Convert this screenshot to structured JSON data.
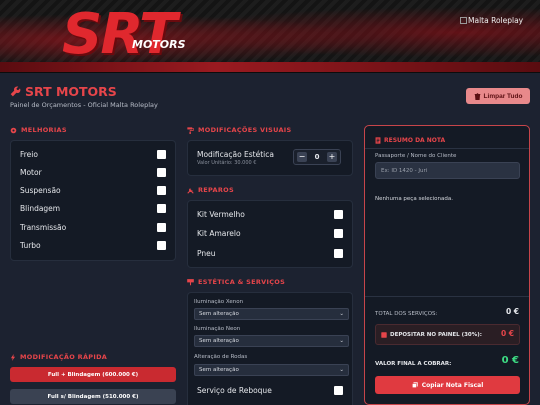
{
  "banner": {
    "logo": "SRT",
    "motors": "MOTORS",
    "image_alt": "Malta Roleplay"
  },
  "header": {
    "title": "SRT MOTORS",
    "subtitle": "Painel de Orçamentos - Oficial Malta Roleplay",
    "clear_label": "Limpar Tudo"
  },
  "melhorias": {
    "title": "MELHORIAS",
    "items": [
      "Freio",
      "Motor",
      "Suspensão",
      "Blindagem",
      "Transmissão",
      "Turbo"
    ]
  },
  "visuais": {
    "title": "MODIFICAÇÕES VISUAIS",
    "name": "Modificação Estética",
    "unit": "Valor Unitário: 30.000 €",
    "qty": "0",
    "minus": "−",
    "plus": "+"
  },
  "reparos": {
    "title": "REPAROS",
    "items": [
      "Kit Vermelho",
      "Kit Amarelo",
      "Pneu"
    ]
  },
  "estetica": {
    "title": "ESTÉTICA & SERVIÇOS",
    "fields": [
      {
        "label": "Iluminação Xenon",
        "value": "Sem alteração"
      },
      {
        "label": "Iluminação Neon",
        "value": "Sem alteração"
      },
      {
        "label": "Alteração de Rodas",
        "value": "Sem alteração"
      }
    ],
    "reboque": "Serviço de Reboque"
  },
  "rapida": {
    "title": "MODIFICAÇÃO RÁPIDA",
    "btn1": "Full + Blindagem (600.000 €)",
    "btn2": "Full s/ Blindagem (510.000 €)"
  },
  "nota": {
    "title": "RESUMO DA NOTA",
    "passport_label": "Passaporte / Nome do Cliente",
    "passport_placeholder": "Ex: ID 1420 - Juri",
    "empty": "Nenhuma peça selecionada.",
    "total_label": "TOTAL DOS SERVIÇOS:",
    "total_value": "0 €",
    "deposit_label": "DEPOSITAR NO PAINEL (30%):",
    "deposit_value": "0 €",
    "final_label": "VALOR FINAL A COBRAR:",
    "final_value": "0 €",
    "copy_label": "Copiar Nota Fiscal"
  },
  "colors": {
    "accent": "#e6454a",
    "panel": "#141a25",
    "bg": "#1c2230",
    "green": "#3ddc84"
  }
}
